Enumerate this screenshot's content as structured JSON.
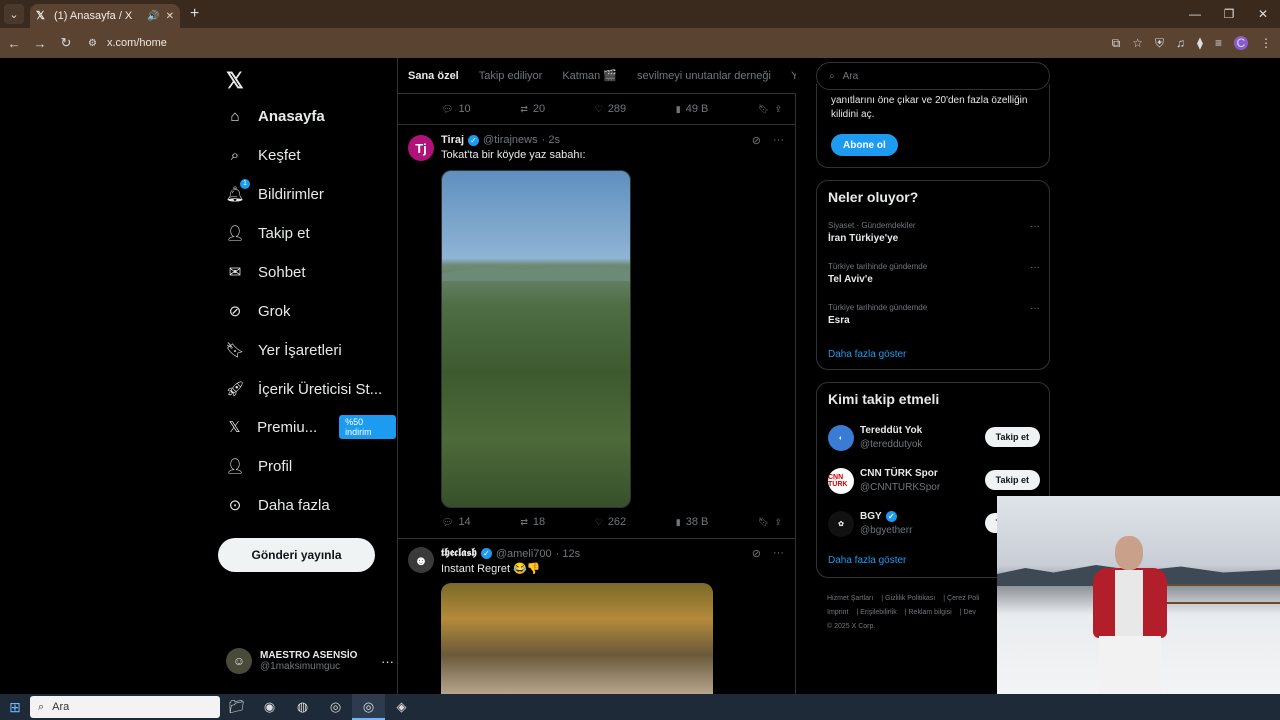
{
  "browser": {
    "tab_title": "(1) Anasayfa / X",
    "url": "x.com/home",
    "profile_initial": "C"
  },
  "nav": {
    "items": [
      {
        "label": "Anasayfa",
        "icon": "home-icon"
      },
      {
        "label": "Keşfet",
        "icon": "search-icon"
      },
      {
        "label": "Bildirimler",
        "icon": "bell-icon",
        "badge": "1"
      },
      {
        "label": "Takip et",
        "icon": "follow-icon"
      },
      {
        "label": "Sohbet",
        "icon": "mail-icon"
      },
      {
        "label": "Grok",
        "icon": "grok-icon"
      },
      {
        "label": "Yer İşaretleri",
        "icon": "bookmark-icon"
      },
      {
        "label": "İçerik Üreticisi St...",
        "icon": "rocket-icon"
      },
      {
        "label": "Premiu...",
        "icon": "x-premium-icon",
        "promo": "%50 indirim"
      },
      {
        "label": "Profil",
        "icon": "profile-icon"
      },
      {
        "label": "Daha fazla",
        "icon": "more-circle-icon"
      }
    ],
    "post_button": "Gönderi yayınla",
    "account": {
      "name": "MAESTRO ASENSİO",
      "handle": "@1maksimumguc"
    }
  },
  "timeline": {
    "tabs": [
      "Sana özel",
      "Takip ediliyor",
      "Katman 🎬",
      "sevilmeyi unutanlar derneği",
      "Ya"
    ],
    "prev_actions": {
      "replies": "10",
      "reposts": "20",
      "likes": "289",
      "views": "49 B"
    },
    "tweets": [
      {
        "name": "Tiraj",
        "handle": "@tirajnews",
        "time": "· 2s",
        "text": "Tokat'ta bir köyde yaz sabahı:",
        "avatar_letter": "Tj",
        "actions": {
          "replies": "14",
          "reposts": "18",
          "likes": "262",
          "views": "38 B"
        }
      },
      {
        "name": "𝖙𝖍𝖊𝖈𝖑𝖆𝖘𝖍",
        "handle": "@ameli700",
        "time": "· 12s",
        "text": "Instant Regret 😂👎"
      }
    ]
  },
  "right": {
    "search_placeholder": "Ara",
    "premium_text": "yanıtlarını öne çıkar ve 20'den fazla özelliğin kilidini aç.",
    "subscribe_button": "Abone ol",
    "trends_title": "Neler oluyor?",
    "trends": [
      {
        "context": "Siyaset · Gündemdekiler",
        "title": "İran Türkiye'ye"
      },
      {
        "context": "Türkiye tarihinde gündemde",
        "title": "Tel Aviv'e"
      },
      {
        "context": "Türkiye tarihinde gündemde",
        "title": "Esra"
      }
    ],
    "trends_more": "Daha fazla göster",
    "who_title": "Kimi takip etmeli",
    "who": [
      {
        "name": "Tereddüt Yok",
        "handle": "@tereddutyok",
        "button": "Takip et"
      },
      {
        "name": "CNN TÜRK Spor",
        "handle": "@CNNTURKSpor",
        "button": "Takip et",
        "avatar_text": "CNN TÜRK"
      },
      {
        "name": "BGY",
        "handle": "@bgyetherr",
        "button": "Takip et",
        "verified": true
      }
    ],
    "who_more": "Daha fazla göster",
    "footer": [
      "Hizmet Şartları",
      "Gizlilik Politikası",
      "Çerez Poli",
      "Imprint",
      "Erişilebilirlik",
      "Reklam bilgisi",
      "Dev",
      "© 2025 X Corp."
    ]
  },
  "taskbar": {
    "search_placeholder": "Ara"
  }
}
